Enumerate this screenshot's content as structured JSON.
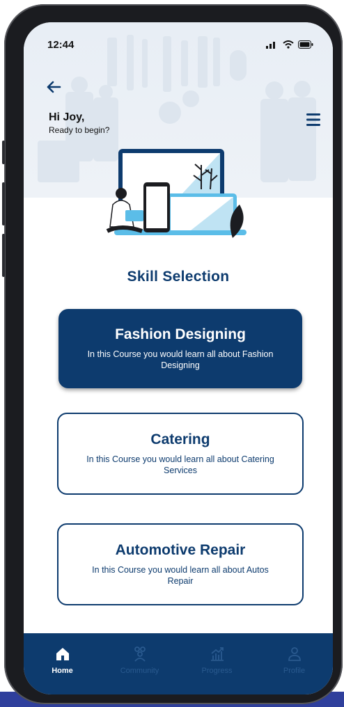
{
  "status": {
    "time": "12:44"
  },
  "header": {
    "greeting": "Hi Joy,",
    "subtitle": "Ready to begin?"
  },
  "section_title": "Skill Selection",
  "courses": [
    {
      "title": "Fashion Designing",
      "description": "In this Course you would learn all about Fashion Designing",
      "selected": true
    },
    {
      "title": "Catering",
      "description": "In this Course you would learn all about Catering Services",
      "selected": false
    },
    {
      "title": "Automotive Repair",
      "description": "In this Course you would learn all about Autos Repair",
      "selected": false
    }
  ],
  "nav": [
    {
      "label": "Home",
      "icon": "home-icon",
      "active": true
    },
    {
      "label": "Community",
      "icon": "community-icon",
      "active": false
    },
    {
      "label": "Progress",
      "icon": "progress-icon",
      "active": false
    },
    {
      "label": "Profile",
      "icon": "profile-icon",
      "active": false
    }
  ],
  "colors": {
    "primary": "#0d3b6e",
    "accent": "#5bbde8",
    "nav_inactive": "#2a5a8f"
  }
}
